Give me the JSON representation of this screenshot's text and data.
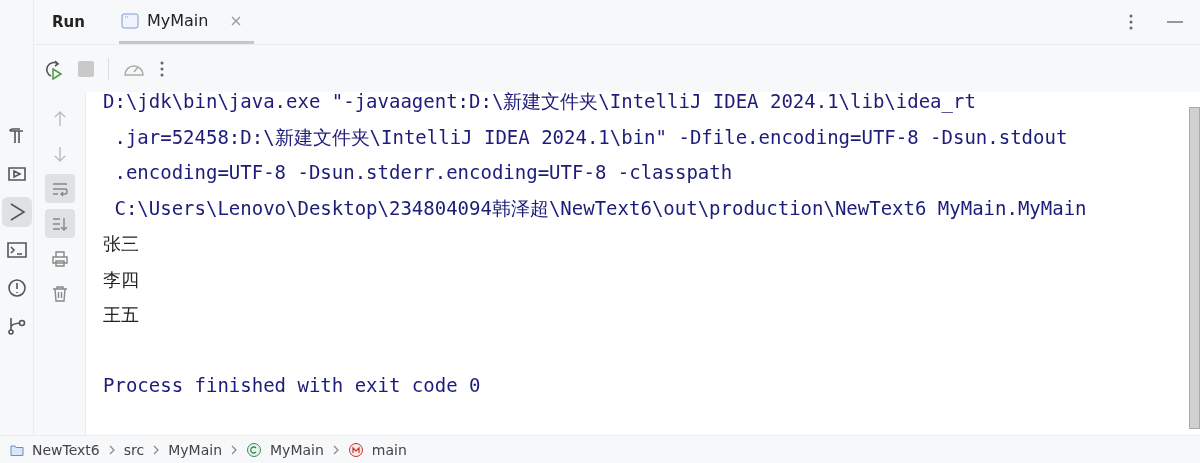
{
  "tool_window": {
    "title": "Run",
    "tabs": [
      {
        "label": "MyMain",
        "selected": true
      }
    ]
  },
  "left_stripe": [
    {
      "kind": "build",
      "selected": false
    },
    {
      "kind": "debug",
      "selected": false
    },
    {
      "kind": "run",
      "selected": true
    },
    {
      "kind": "terminal",
      "selected": false
    },
    {
      "kind": "problems",
      "selected": false
    },
    {
      "kind": "git",
      "selected": false
    }
  ],
  "console_gutter": [
    {
      "kind": "up",
      "on": false
    },
    {
      "kind": "down",
      "on": false
    },
    {
      "kind": "wrap",
      "on": true
    },
    {
      "kind": "scroll-end",
      "on": true
    },
    {
      "kind": "print",
      "on": false
    },
    {
      "kind": "delete",
      "on": false
    }
  ],
  "console": [
    {
      "kind": "system",
      "text": "D:\\jdk\\bin\\java.exe \"-javaagent:D:\\新建文件夹\\IntelliJ IDEA 2024.1\\lib\\idea_rt"
    },
    {
      "kind": "system",
      "text": " .jar=52458:D:\\新建文件夹\\IntelliJ IDEA 2024.1\\bin\" -Dfile.encoding=UTF-8 -Dsun.stdout"
    },
    {
      "kind": "system",
      "text": " .encoding=UTF-8 -Dsun.stderr.encoding=UTF-8 -classpath"
    },
    {
      "kind": "system",
      "text": " C:\\Users\\Lenovo\\Desktop\\234804094韩泽超\\NewText6\\out\\production\\NewText6 MyMain.MyMain"
    },
    {
      "kind": "output",
      "text": "张三"
    },
    {
      "kind": "output",
      "text": "李四"
    },
    {
      "kind": "output",
      "text": "王五"
    },
    {
      "kind": "blank"
    },
    {
      "kind": "system",
      "text": "Process finished with exit code 0"
    }
  ],
  "status_bar": {
    "breadcrumbs": [
      {
        "kind": "project",
        "label": "NewText6"
      },
      {
        "kind": "folder",
        "label": "src"
      },
      {
        "kind": "package",
        "label": "MyMain"
      },
      {
        "kind": "class",
        "label": "MyMain"
      },
      {
        "kind": "method",
        "label": "main"
      }
    ]
  }
}
